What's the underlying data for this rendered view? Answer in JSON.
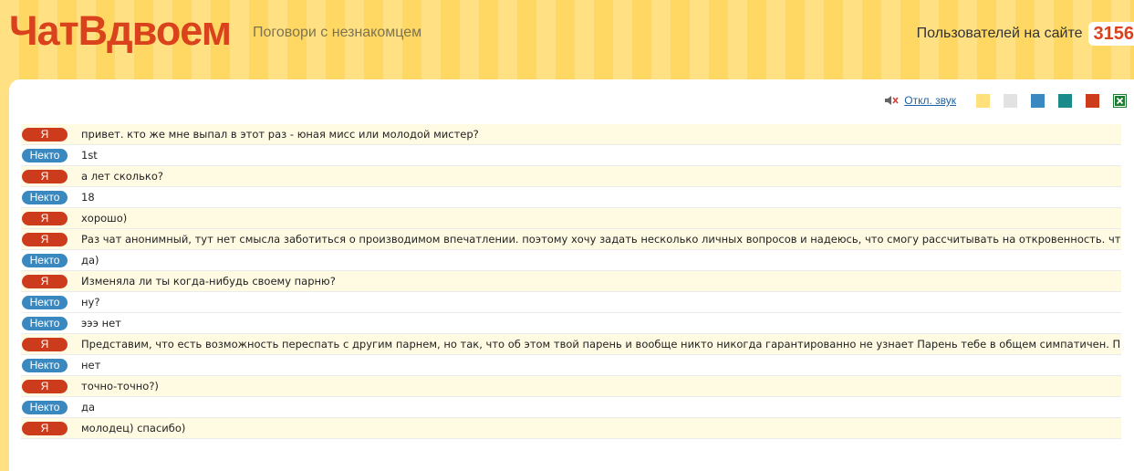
{
  "header": {
    "logo": "ЧатВдвоем",
    "tagline": "Поговори с незнакомцем",
    "online_label": "Пользователей на сайте",
    "online_count": "3156"
  },
  "toolbar": {
    "sound_icon": "speaker-mute-icon",
    "sound_label": "Откл. звук",
    "swatches": [
      {
        "name": "yellow",
        "color": "#ffe07a"
      },
      {
        "name": "gray",
        "color": "#e2e2e2"
      },
      {
        "name": "blue",
        "color": "#3a88c0"
      },
      {
        "name": "teal",
        "color": "#1b8a8a"
      },
      {
        "name": "red",
        "color": "#cc3c1c"
      }
    ],
    "export_icon": "excel-icon"
  },
  "labels": {
    "me": "Я",
    "other": "Некто"
  },
  "colors": {
    "accent": "#d9421c",
    "me_badge": "#cc3c1c",
    "other_badge": "#3a88c0"
  },
  "messages": [
    {
      "sender": "me",
      "label": "Я",
      "text": "привет. кто же мне выпал в этот раз - юная мисс или молодой мистер?"
    },
    {
      "sender": "other",
      "label": "Некто",
      "text": "1st"
    },
    {
      "sender": "me",
      "label": "Я",
      "text": "а лет сколько?"
    },
    {
      "sender": "other",
      "label": "Некто",
      "text": "18"
    },
    {
      "sender": "me",
      "label": "Я",
      "text": "хорошо)"
    },
    {
      "sender": "me",
      "label": "Я",
      "text": "Раз чат анонимный, тут нет смысла заботиться о производимом впечатлении. поэтому хочу задать несколько личных вопросов и надеюсь, что смогу рассчитывать на откровенность. что скажешь?"
    },
    {
      "sender": "other",
      "label": "Некто",
      "text": "да)"
    },
    {
      "sender": "me",
      "label": "Я",
      "text": "Изменяла ли ты когда-нибудь своему парню?"
    },
    {
      "sender": "other",
      "label": "Некто",
      "text": "ну?"
    },
    {
      "sender": "other",
      "label": "Некто",
      "text": "эээ нет"
    },
    {
      "sender": "me",
      "label": "Я",
      "text": "Представим, что есть возможность переспать с другим парнем, но так, что об этом твой парень и вообще никто никогда гарантированно не узнает Парень тебе в общем симпатичен. Переспишь?"
    },
    {
      "sender": "other",
      "label": "Некто",
      "text": "нет"
    },
    {
      "sender": "me",
      "label": "Я",
      "text": "точно-точно?)"
    },
    {
      "sender": "other",
      "label": "Некто",
      "text": "да"
    },
    {
      "sender": "me",
      "label": "Я",
      "text": "молодец) спасибо)"
    }
  ]
}
